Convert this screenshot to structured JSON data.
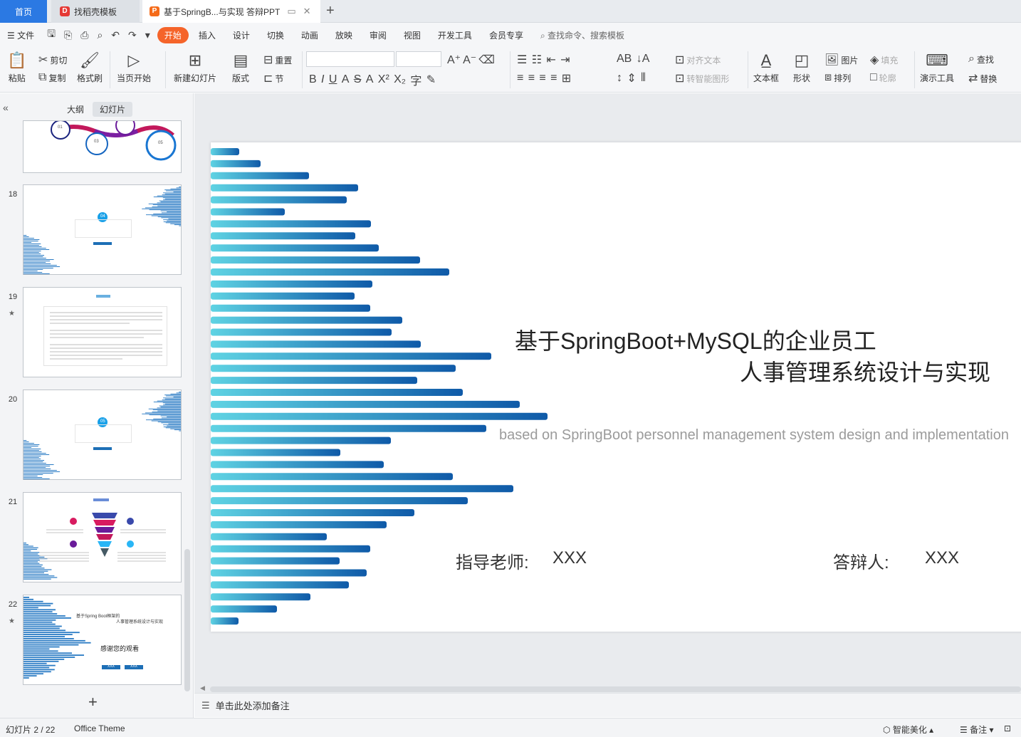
{
  "tabs": {
    "home": "首页",
    "template": "找稻壳模板",
    "document": "基于SpringB...与实现 答辩PPT"
  },
  "menu": {
    "file": "文件",
    "items": [
      "开始",
      "插入",
      "设计",
      "切换",
      "动画",
      "放映",
      "审阅",
      "视图",
      "开发工具",
      "会员专享"
    ],
    "search": "查找命令、搜索模板"
  },
  "ribbon": {
    "paste": "粘贴",
    "cut": "剪切",
    "copy": "复制",
    "format_painter": "格式刷",
    "from_current": "当页开始",
    "new_slide": "新建幻灯片",
    "layout": "版式",
    "reset": "重置",
    "section": "节",
    "align_text": "对齐文本",
    "smart_art": "转智能图形",
    "textbox": "文本框",
    "shape": "形状",
    "picture": "图片",
    "arrange": "排列",
    "fill": "填充",
    "outline": "轮廓",
    "present_tools": "演示工具",
    "find": "查找",
    "replace": "替换"
  },
  "left_panel": {
    "outline_tab": "大纲",
    "slides_tab": "幻灯片",
    "thumbs": [
      {
        "num": "",
        "text1": "01",
        "text2": "03",
        "text3": "05"
      },
      {
        "num": "18",
        "badge": "04"
      },
      {
        "num": "19"
      },
      {
        "num": "20",
        "badge": "05"
      },
      {
        "num": "21"
      },
      {
        "num": "22",
        "title1": "基于Spring Boot框架的",
        "title2": "人事管理系统设计与实现",
        "thanks": "感谢您的观看",
        "b1": "XXX",
        "b2": "XXX"
      }
    ],
    "add": "+"
  },
  "slide": {
    "title_line1": "基于SpringBoot+MySQL的企业员工",
    "title_line2": "人事管理系统设计与实现",
    "subtitle": "based on SpringBoot personnel management system design and implementation",
    "advisor_label": "指导老师:",
    "advisor_value": "XXX",
    "defender_label": "答辩人:",
    "defender_value": "XXX",
    "bar_lengths": [
      40,
      70,
      138,
      207,
      191,
      104,
      225,
      203,
      236,
      294,
      335,
      227,
      202,
      224,
      269,
      254,
      295,
      394,
      344,
      290,
      354,
      434,
      473,
      387,
      253,
      182,
      243,
      340,
      425,
      361,
      286,
      247,
      163,
      224,
      181,
      219,
      194,
      140,
      93,
      39
    ],
    "colors": {
      "light": "#5fd3e3",
      "dark": "#0f5aa8"
    }
  },
  "notes": "单击此处添加备注",
  "statusbar": {
    "slide_count": "幻灯片 2 / 22",
    "theme": "Office Theme",
    "beautify": "智能美化",
    "notes": "备注"
  }
}
